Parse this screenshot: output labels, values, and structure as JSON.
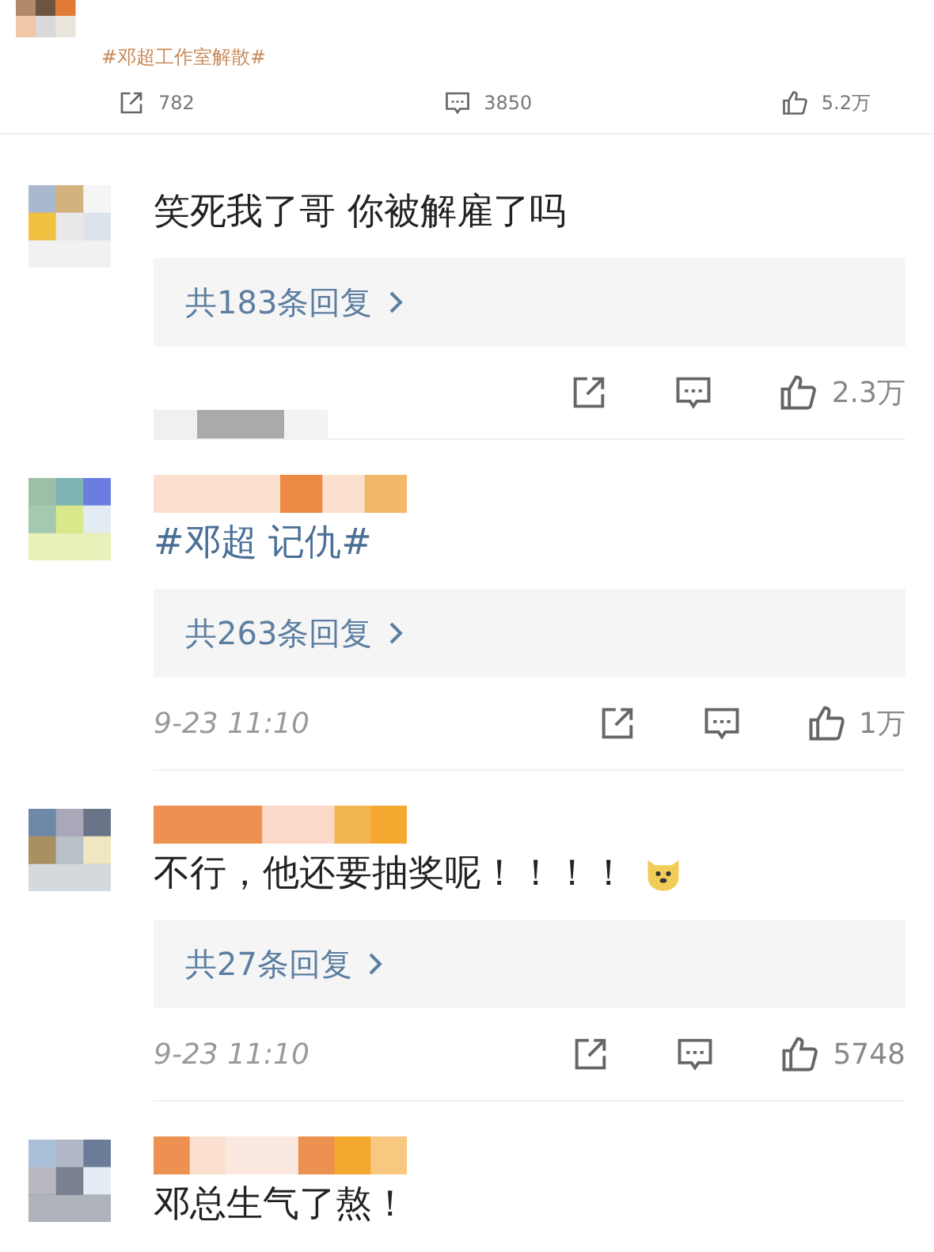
{
  "post": {
    "hashtag": "#邓超工作室解散#",
    "reposts": "782",
    "comments": "3850",
    "likes": "5.2万"
  },
  "comments": [
    {
      "has_name": false,
      "kind": "plain",
      "text": "笑死我了哥 你被解雇了吗",
      "emoji": false,
      "replies": "共183条回复",
      "likes": "2.3万"
    },
    {
      "has_name": true,
      "kind": "hashtag",
      "text": "#邓超 记仇#",
      "emoji": false,
      "replies": "共263条回复",
      "time": "9-23 11:10",
      "likes": "1万"
    },
    {
      "has_name": true,
      "kind": "plain",
      "text": "不行，他还要抽奖呢！！！！",
      "emoji": true,
      "replies": "共27条回复",
      "time": "9-23 11:10",
      "likes": "5748"
    },
    {
      "has_name": true,
      "kind": "plain",
      "text": "邓总生气了熬！",
      "emoji": false
    }
  ]
}
